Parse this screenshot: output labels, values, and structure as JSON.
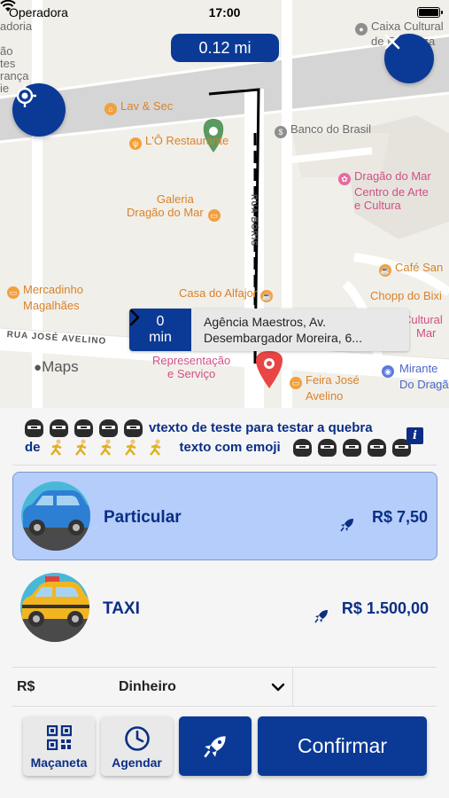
{
  "status_bar": {
    "carrier": "Operadora",
    "time": "17:00"
  },
  "map": {
    "distance": "0.12 mi",
    "pois": {
      "lav_sec": "Lav & Sec",
      "lo_restaurante": "L'Ô Restaurante",
      "banco_brasil": "Banco do Brasil",
      "caixa_cultural_1": "Caixa Cultural",
      "caixa_cultural_2": "de Fortaleza",
      "galeria_1": "Galeria",
      "galeria_2": "Dragão do Mar",
      "dragao_1": "Dragão do Mar",
      "dragao_2": "Centro de Arte",
      "dragao_3": "e Cultura",
      "cafe_san": "Café San",
      "chopp": "Chopp do Bixi",
      "mercadinho_1": "Mercadinho",
      "mercadinho_2": "Magalhães",
      "casa_alfajor": "Casa do Alfajor",
      "cultural_right_1": "Cultural",
      "cultural_right_2": "Mar",
      "represent_1": "Representação",
      "represent_2": "e Serviço",
      "feira_1": "Feira José",
      "feira_2": "Avelino",
      "mirante_1": "Mirante",
      "mirante_2": "Do Dragão",
      "left_edge_1": "adoria",
      "left_edge_2": "ão",
      "left_edge_3": "tes",
      "left_edge_4": "rança",
      "left_edge_5": "ie"
    },
    "streets": {
      "rua_jose_avelino": "RUA JOSÉ AVELINO",
      "rua_boris": "RUA BÓRIS"
    },
    "route": {
      "eta_value": "0",
      "eta_unit": "min",
      "address_line1": "Agência Maestros, Av.",
      "address_line2": "Desembargador Moreira, 6..."
    },
    "logo": "Maps"
  },
  "notice": {
    "line1_text": "vtexto de teste para testar a quebra",
    "line2_prefix": "de",
    "line2_text": "texto com emoji"
  },
  "rides": [
    {
      "name": "Particular",
      "price": "R$ 7,50",
      "selected": true
    },
    {
      "name": "TAXI",
      "price": "R$ 1.500,00",
      "selected": false
    }
  ],
  "payment": {
    "currency": "R$",
    "method": "Dinheiro"
  },
  "actions": {
    "macaneta": "Maçaneta",
    "agendar": "Agendar",
    "confirm": "Confirmar"
  },
  "colors": {
    "brand": "#0b3a96",
    "selected_card": "#b5cdfb",
    "text_brand": "#0b2e85"
  }
}
